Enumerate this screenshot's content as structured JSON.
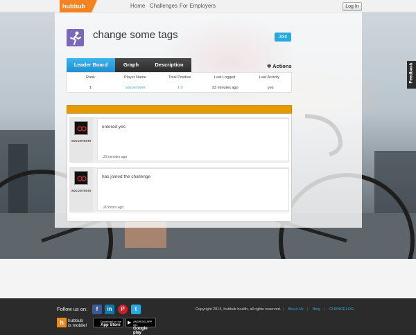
{
  "nav": {
    "logo_text": "hubbub",
    "links": [
      "Home",
      "Challenges",
      "For Employers"
    ],
    "login_label": "Log In"
  },
  "challenge": {
    "title": "change some tags",
    "join_label": "Join",
    "icon": "runner-icon"
  },
  "tabs": [
    {
      "label": "Leader Board",
      "active": true
    },
    {
      "label": "Graph",
      "active": false
    },
    {
      "label": "Description",
      "active": false
    }
  ],
  "actions_label": "Actions",
  "leaderboard": {
    "columns": [
      "Rank",
      "Player Name",
      "Total Positive",
      "Last Logged",
      "Last Activity"
    ],
    "rows": [
      {
        "rank": "1",
        "player": "soccermom",
        "total": "1.0",
        "logged": "23 minutes ago",
        "activity": "yes"
      }
    ]
  },
  "feed": [
    {
      "user": "soccermom",
      "message": "entered yes",
      "time": "23 minutes ago"
    },
    {
      "user": "soccermom",
      "message": "has joined the challenge",
      "time": "20 hours ago"
    }
  ],
  "feedback_label": "Feedback",
  "footer": {
    "follow_label": "Follow us on:",
    "social": [
      {
        "icon": "facebook-icon",
        "glyph": "f",
        "color": "#3b5998"
      },
      {
        "icon": "linkedin-icon",
        "glyph": "in",
        "color": "#0e76a8"
      },
      {
        "icon": "pinterest-icon",
        "glyph": "P",
        "color": "#cb2027"
      },
      {
        "icon": "twitter-icon",
        "glyph": "t",
        "color": "#2aa8e0"
      }
    ],
    "copyright": "Copyright 2014, hubbub health, all rights reserved.",
    "links": [
      "About Us",
      "Blog",
      "CHANGELOG"
    ],
    "mobile_logo": "h",
    "mobile_text_1": "hubbub",
    "mobile_text_2": "is mobile!",
    "app_store": {
      "small": "Download on the",
      "big": "App Store"
    },
    "google_play": {
      "small": "ANDROID APP ON",
      "big": "Google play"
    }
  },
  "colors": {
    "accent": "#2aa8e0",
    "brand_orange": "#f58220",
    "feed_bar": "#e59a00"
  }
}
